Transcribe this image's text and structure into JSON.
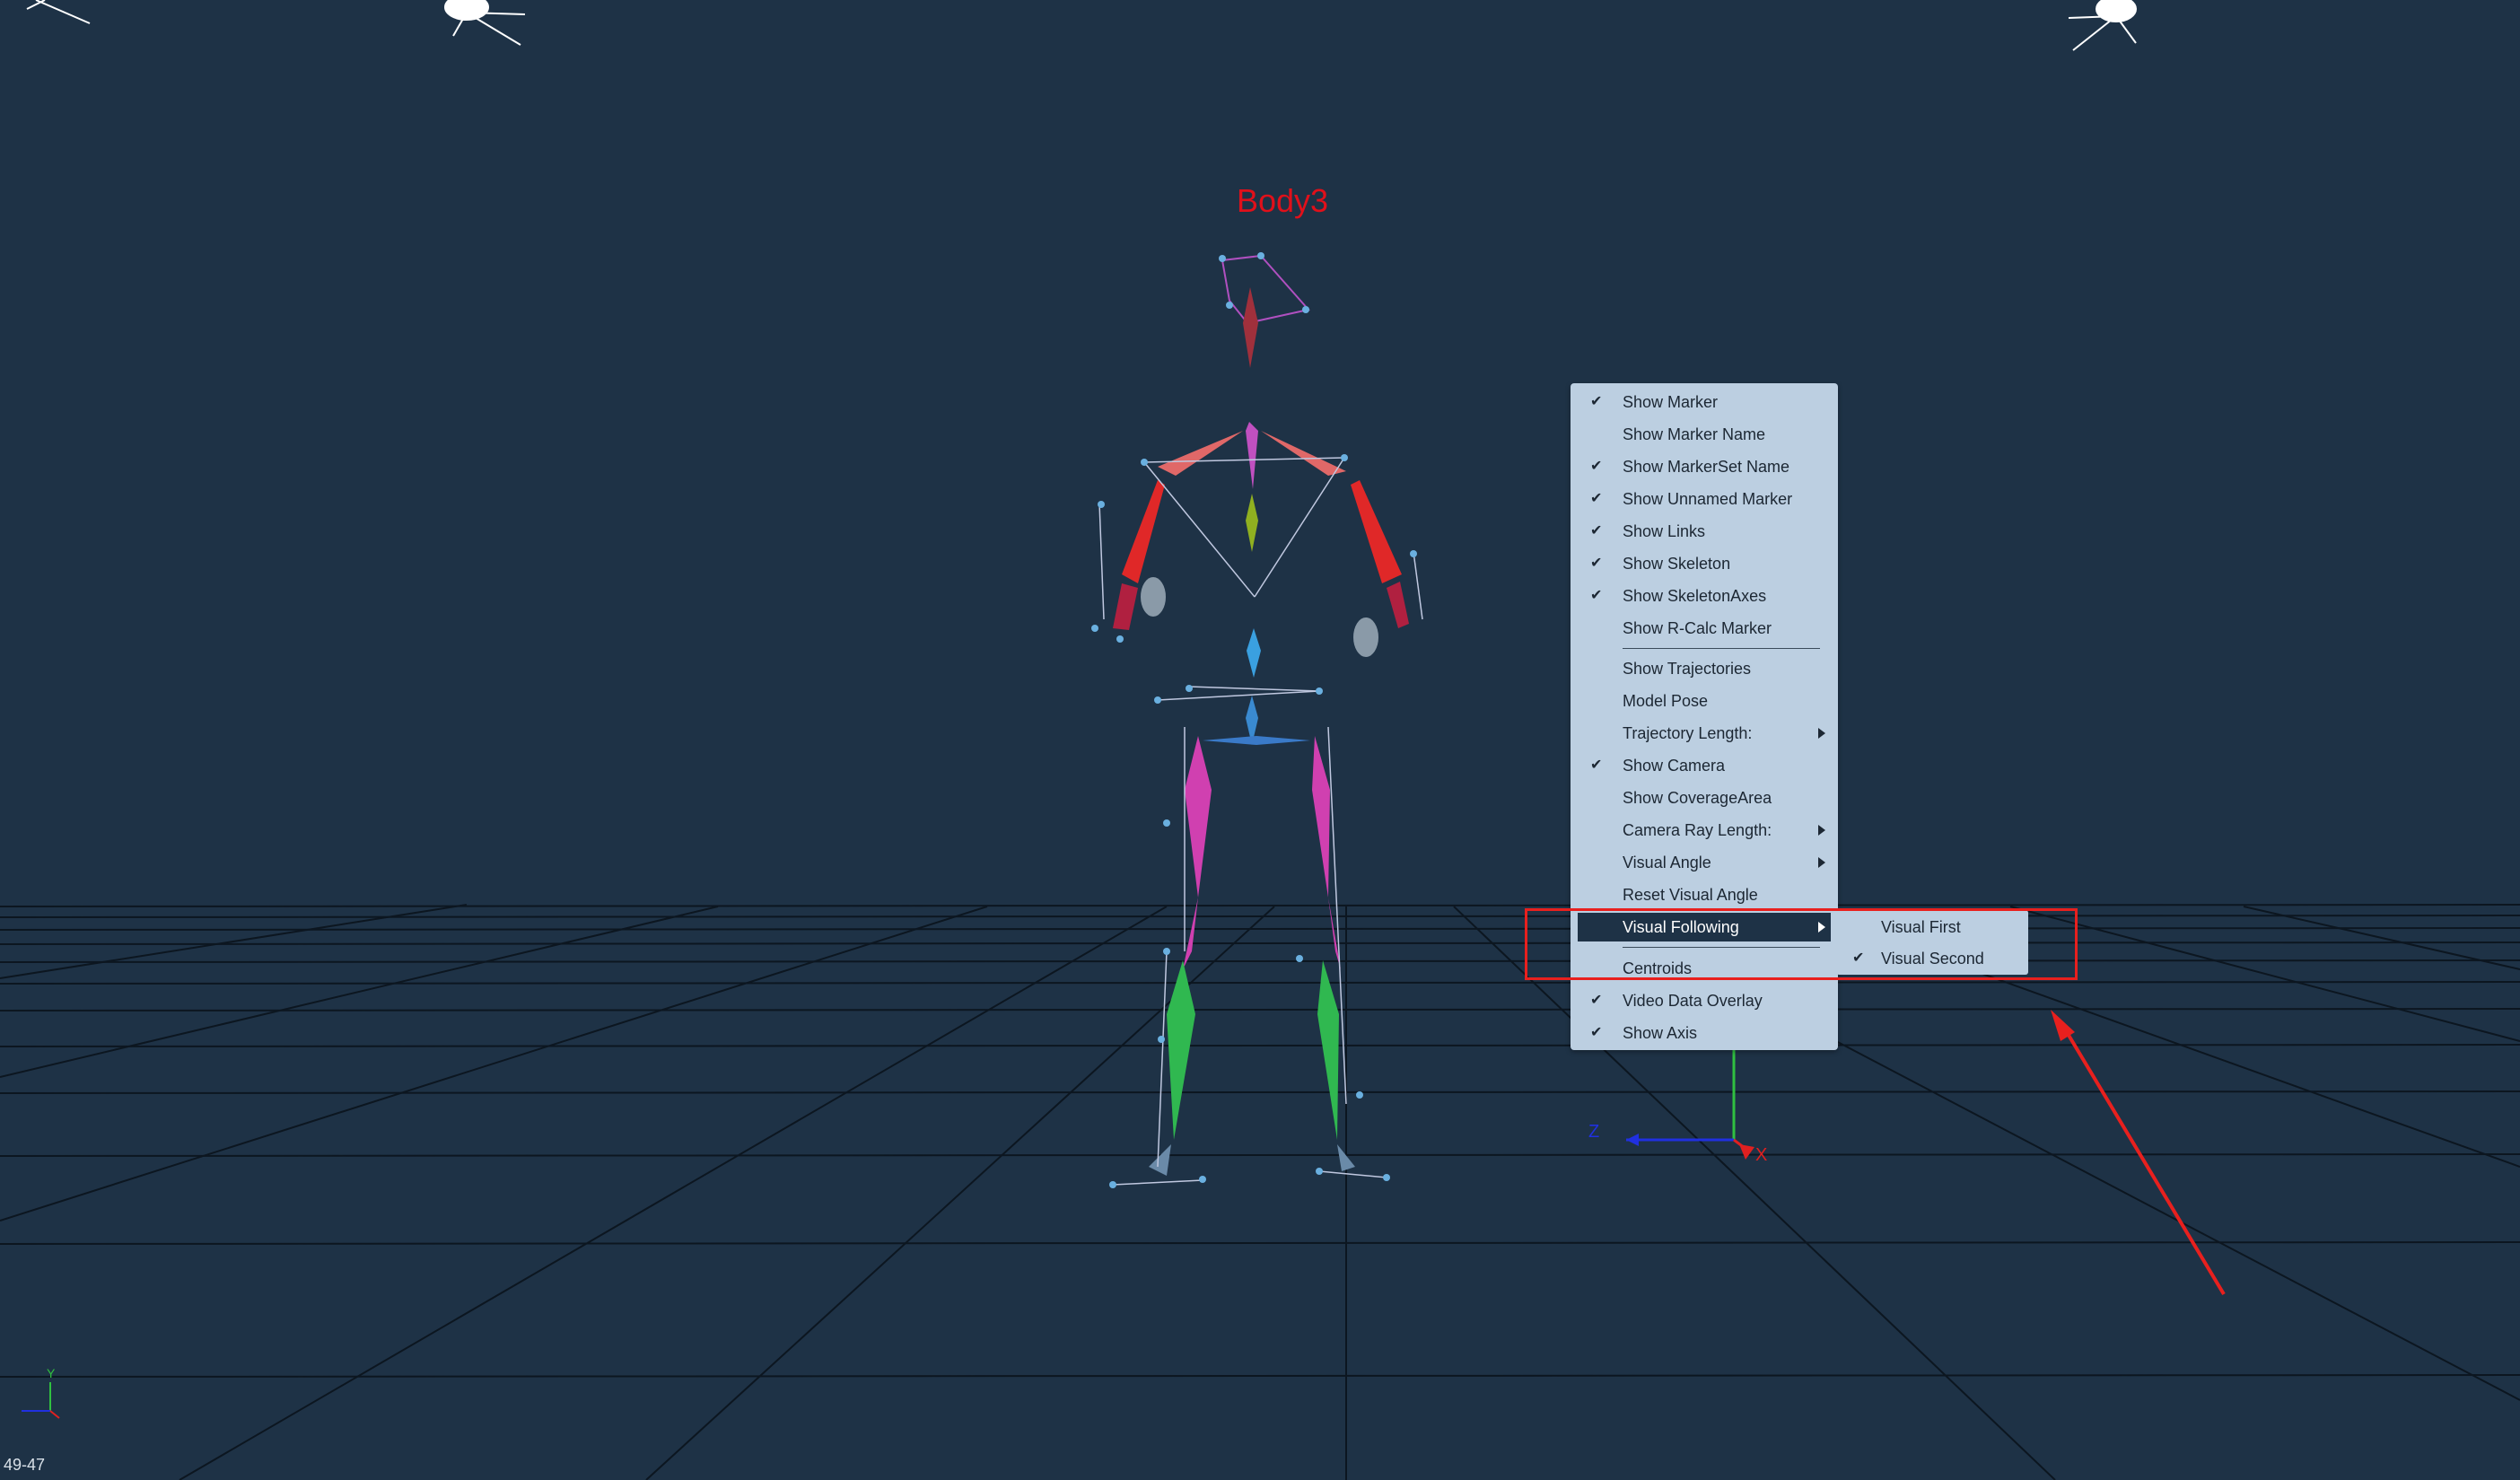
{
  "viewport": {
    "model_label": "Body3",
    "corner_label": "49-47",
    "axis_labels": {
      "z": "Z",
      "x": "X",
      "y": "Y"
    }
  },
  "context_menu": {
    "items": [
      {
        "label": "Show Marker",
        "checked": "✔"
      },
      {
        "label": "Show Marker Name",
        "checked": ""
      },
      {
        "label": "Show MarkerSet Name",
        "checked": "✔"
      },
      {
        "label": "Show Unnamed Marker",
        "checked": "✔"
      },
      {
        "label": "Show Links",
        "checked": "✔"
      },
      {
        "label": "Show Skeleton",
        "checked": "✔"
      },
      {
        "label": "Show SkeletonAxes",
        "checked": "✔"
      },
      {
        "label": "Show R-Calc Marker",
        "checked": ""
      },
      {
        "label": "Show Trajectories",
        "checked": ""
      },
      {
        "label": "Model Pose",
        "checked": ""
      },
      {
        "label": "Trajectory Length:",
        "checked": "",
        "submenu": true
      },
      {
        "label": "Show Camera",
        "checked": "✔"
      },
      {
        "label": "Show CoverageArea",
        "checked": ""
      },
      {
        "label": "Camera Ray Length:",
        "checked": "",
        "submenu": true
      },
      {
        "label": "Visual Angle",
        "checked": "",
        "submenu": true
      },
      {
        "label": "Reset Visual Angle",
        "checked": ""
      },
      {
        "label": "Visual Following",
        "checked": "",
        "submenu": true,
        "highlighted": true
      },
      {
        "label": "Centroids",
        "checked": ""
      },
      {
        "label": "Video Data Overlay",
        "checked": "✔"
      },
      {
        "label": "Show Axis",
        "checked": "✔"
      }
    ]
  },
  "submenu": {
    "items": [
      {
        "label": "Visual First",
        "checked": ""
      },
      {
        "label": "Visual Second",
        "checked": "✔"
      }
    ]
  },
  "colors": {
    "background": "#1e3246",
    "menu_bg": "#bccfe1",
    "highlight": "#1e3246",
    "annotation_red": "#e8201e"
  }
}
